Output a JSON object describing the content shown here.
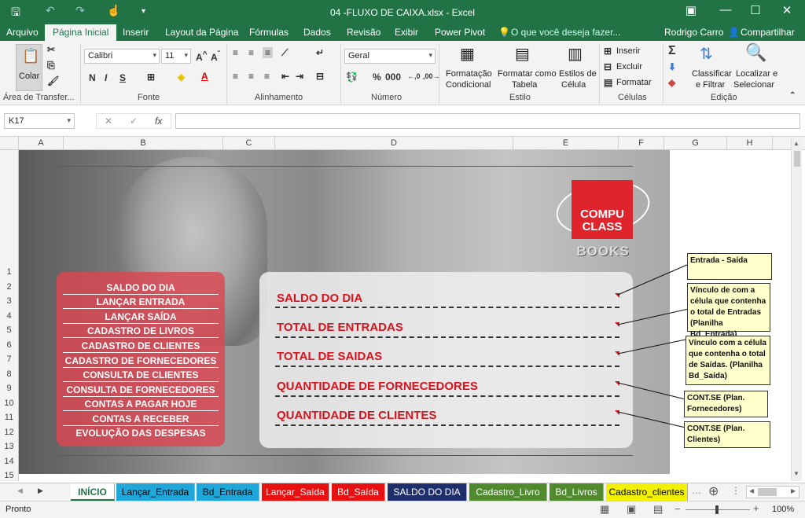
{
  "titlebar": {
    "title": "04 -FLUXO DE CAIXA.xlsx - Excel",
    "icons": [
      "save-icon",
      "undo-icon",
      "redo-icon",
      "touch-mode-icon",
      "customize-icon"
    ],
    "window_controls": [
      "ribbon-display-icon",
      "minimize-icon",
      "maximize-icon",
      "close-icon"
    ]
  },
  "ribbon_tabs": [
    "Arquivo",
    "Página Inicial",
    "Inserir",
    "Layout da Página",
    "Fórmulas",
    "Dados",
    "Revisão",
    "Exibir",
    "Power Pivot"
  ],
  "active_tab": "Página Inicial",
  "tell_me": "O que você deseja fazer...",
  "user": "Rodrigo Carro",
  "share": "Compartilhar",
  "ribbon": {
    "clipboard": {
      "paste": "Colar",
      "group": "Área de Transfer..."
    },
    "font": {
      "name": "Calibri",
      "size": "11",
      "bold": "N",
      "italic": "I",
      "underline": "S",
      "group": "Fonte"
    },
    "alignment": {
      "group": "Alinhamento"
    },
    "number": {
      "format": "Geral",
      "percent": "%",
      "thousands": "000",
      "group": "Número"
    },
    "styles": {
      "cond1": "Formatação",
      "cond2": "Condicional",
      "table1": "Formatar como",
      "table2": "Tabela",
      "cell1": "Estilos de",
      "cell2": "Célula",
      "group": "Estilo"
    },
    "cells": {
      "insert": "Inserir",
      "delete": "Excluir",
      "format": "Formatar",
      "group": "Células"
    },
    "editing": {
      "sort1": "Classificar",
      "sort2": "e Filtrar",
      "find1": "Localizar e",
      "find2": "Selecionar",
      "group": "Edição"
    }
  },
  "formula_bar": {
    "name_box": "K17",
    "fx": "fx",
    "value": ""
  },
  "columns": [
    "A",
    "B",
    "C",
    "D",
    "E",
    "F",
    "G",
    "H"
  ],
  "rows": [
    "1",
    "2",
    "3",
    "4",
    "5",
    "6",
    "7",
    "8",
    "9",
    "10",
    "11",
    "12",
    "13",
    "14",
    "15"
  ],
  "menu_items": [
    "SALDO DO DIA",
    "LANÇAR ENTRADA",
    "LANÇAR SAÍDA",
    "CADASTRO DE LIVROS",
    "CADASTRO DE CLIENTES",
    "CADASTRO DE FORNECEDORES",
    "CONSULTA DE CLIENTES",
    "CONSULTA DE FORNECEDORES",
    "CONTAS A PAGAR HOJE",
    "CONTAS A RECEBER",
    "EVOLUÇÃO DAS DESPESAS"
  ],
  "panel_labels": [
    "SALDO DO DIA",
    "TOTAL DE ENTRADAS",
    "TOTAL DE SAIDAS",
    "QUANTIDADE DE FORNECEDORES",
    "QUANTIDADE DE CLIENTES"
  ],
  "logo": {
    "line1": "COMPU",
    "line2": "CLASS",
    "books": "BOOKS"
  },
  "notes": [
    "Entrada - Saída",
    "Vínculo de com a célula que contenha o total de Entradas (Planilha Bd_Entrada)",
    "Vínculo com a célula que contenha o total de Saídas. (Planilha Bd_Saída)",
    "CONT.SE (Plan. Fornecedores)",
    "CONT.SE (Plan. Clientes)"
  ],
  "sheet_tabs": [
    {
      "label": "INÍCIO",
      "color": "#ffffff",
      "text": "#217346"
    },
    {
      "label": "Lançar_Entrada",
      "color": "#1fa7d9",
      "text": "#000000"
    },
    {
      "label": "Bd_Entrada",
      "color": "#1fa7d9",
      "text": "#000000"
    },
    {
      "label": "Lançar_Saída",
      "color": "#e81010",
      "text": "#ffffff"
    },
    {
      "label": "Bd_Saída",
      "color": "#e81010",
      "text": "#ffffff"
    },
    {
      "label": "SALDO DO DIA",
      "color": "#1f2f6b",
      "text": "#ffffff"
    },
    {
      "label": "Cadastro_Livro",
      "color": "#4f8a2e",
      "text": "#ffffff"
    },
    {
      "label": "Bd_Livros",
      "color": "#4f8a2e",
      "text": "#ffffff"
    },
    {
      "label": "Cadastro_clientes",
      "color": "#f2f200",
      "text": "#000000"
    }
  ],
  "status": {
    "ready": "Pronto",
    "zoom": "100%"
  }
}
